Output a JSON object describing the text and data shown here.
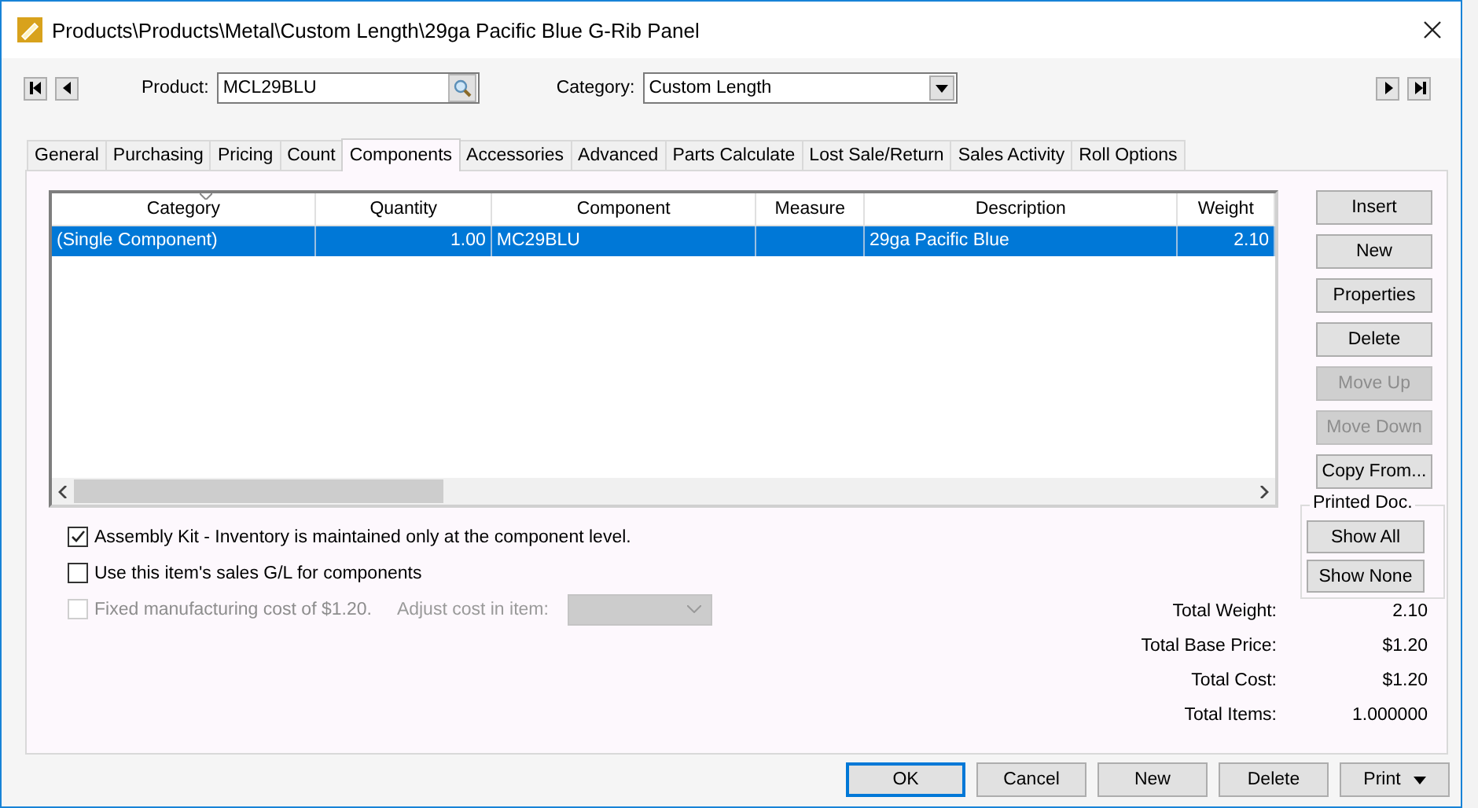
{
  "window": {
    "title": "Products\\Products\\Metal\\Custom Length\\29ga Pacific Blue G-Rib Panel"
  },
  "product": {
    "label": "Product:",
    "value": "MCL29BLU"
  },
  "category": {
    "label": "Category:",
    "value": "Custom Length"
  },
  "tabs": [
    {
      "label": "General",
      "selected": false
    },
    {
      "label": "Purchasing",
      "selected": false
    },
    {
      "label": "Pricing",
      "selected": false
    },
    {
      "label": "Count",
      "selected": false
    },
    {
      "label": "Components",
      "selected": true
    },
    {
      "label": "Accessories",
      "selected": false
    },
    {
      "label": "Advanced",
      "selected": false
    },
    {
      "label": "Parts Calculate",
      "selected": false
    },
    {
      "label": "Lost Sale/Return",
      "selected": false
    },
    {
      "label": "Sales Activity",
      "selected": false
    },
    {
      "label": "Roll Options",
      "selected": false
    }
  ],
  "grid": {
    "columns": [
      {
        "label": "Category",
        "sorted": true
      },
      {
        "label": "Quantity",
        "sorted": false
      },
      {
        "label": "Component",
        "sorted": false
      },
      {
        "label": "Measure",
        "sorted": false
      },
      {
        "label": "Description",
        "sorted": false
      },
      {
        "label": "Weight",
        "sorted": false
      }
    ],
    "rows": [
      {
        "selected": true,
        "cells": [
          "(Single Component)",
          "1.00",
          "MC29BLU",
          "",
          "29ga Pacific Blue",
          "2.10"
        ]
      }
    ]
  },
  "side_buttons": [
    {
      "label": "Insert",
      "disabled": false
    },
    {
      "label": "New",
      "disabled": false
    },
    {
      "label": "Properties",
      "disabled": false
    },
    {
      "label": "Delete",
      "disabled": false
    },
    {
      "label": "Move Up",
      "disabled": true
    },
    {
      "label": "Move Down",
      "disabled": true
    },
    {
      "label": "Copy From...",
      "disabled": false
    }
  ],
  "printed_doc": {
    "title": "Printed Doc.",
    "buttons": [
      "Show All",
      "Show None"
    ]
  },
  "options": [
    {
      "label": "Assembly Kit - Inventory is maintained only at the component level.",
      "checked": true,
      "disabled": false
    },
    {
      "label": "Use this item's sales G/L for components",
      "checked": false,
      "disabled": false
    },
    {
      "label": "Fixed manufacturing cost of $1.20.",
      "checked": false,
      "disabled": true
    }
  ],
  "adjust": {
    "label": "Adjust cost in item:",
    "disabled": true
  },
  "totals": [
    {
      "label": "Total Weight:",
      "value": "2.10"
    },
    {
      "label": "Total Base Price:",
      "value": "$1.20"
    },
    {
      "label": "Total Cost:",
      "value": "$1.20"
    },
    {
      "label": "Total Items:",
      "value": "1.000000"
    }
  ],
  "footer_buttons": [
    {
      "label": "OK",
      "kind": "default"
    },
    {
      "label": "Cancel",
      "kind": "plain"
    },
    {
      "label": "New",
      "kind": "plain"
    },
    {
      "label": "Delete",
      "kind": "plain"
    },
    {
      "label": "Print",
      "kind": "menu"
    }
  ]
}
